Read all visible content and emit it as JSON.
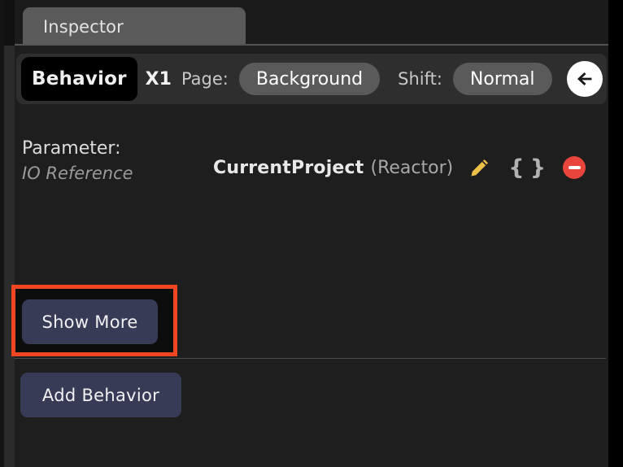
{
  "window": {
    "accent_red": "#f04622",
    "button_fill": "#373b56",
    "panel_bg": "#1e1e1e"
  },
  "tabbar": {
    "tabs": [
      {
        "label": "Inspector",
        "active": true
      }
    ]
  },
  "toolbar": {
    "behavior_badge": "Behavior",
    "count": "X1",
    "page_label": "Page:",
    "page_value": "Background",
    "shift_label": "Shift:",
    "shift_value": "Normal",
    "back_icon": "arrow-left-icon"
  },
  "parameter": {
    "title": "Parameter:",
    "subtitle": "IO Reference",
    "value_name": "CurrentProject",
    "value_type": "(Reactor)",
    "icons": [
      {
        "name": "pencil-edit-icon",
        "color": "#edc04a"
      },
      {
        "name": "curly-braces-icon",
        "glyph": "{ }",
        "color": "#b2b2b2"
      },
      {
        "name": "remove-minus-icon",
        "color": "#e8453c"
      }
    ]
  },
  "actions": {
    "show_more": "Show More",
    "add_behavior": "Add Behavior"
  }
}
